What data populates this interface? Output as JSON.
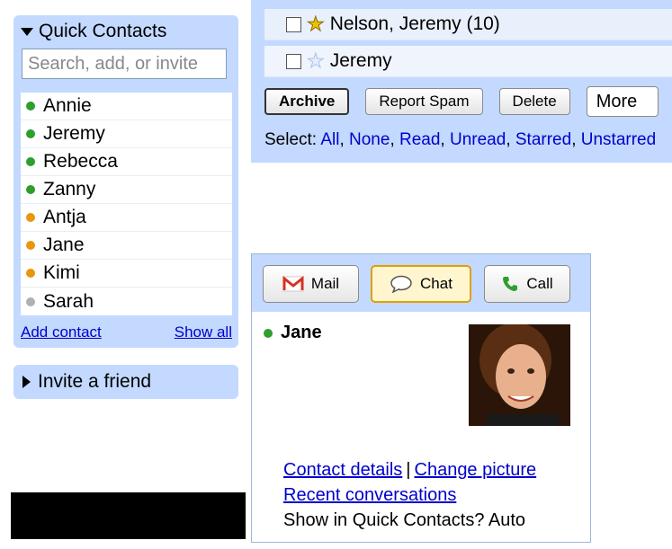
{
  "quick_contacts": {
    "title": "Quick Contacts",
    "search_placeholder": "Search, add, or invite",
    "contacts": [
      {
        "name": "Annie",
        "status": "online"
      },
      {
        "name": "Jeremy",
        "status": "online"
      },
      {
        "name": "Rebecca",
        "status": "online"
      },
      {
        "name": "Zanny",
        "status": "online"
      },
      {
        "name": "Antja",
        "status": "idle"
      },
      {
        "name": "Jane",
        "status": "idle"
      },
      {
        "name": "Kimi",
        "status": "idle"
      },
      {
        "name": "Sarah",
        "status": "offline"
      }
    ],
    "add_contact_label": "Add contact",
    "show_all_label": "Show all"
  },
  "invite": {
    "label": "Invite a friend"
  },
  "mail_list": {
    "rows": [
      {
        "sender": "Nelson, Jeremy (10)",
        "starred": true
      },
      {
        "sender": "Jeremy",
        "starred": false
      }
    ],
    "toolbar": {
      "archive_label": "Archive",
      "report_spam_label": "Report Spam",
      "delete_label": "Delete",
      "more_label": "More"
    },
    "select": {
      "prefix": "Select:",
      "all": "All",
      "none": "None",
      "read": "Read",
      "unread": "Unread",
      "starred": "Starred",
      "unstarred": "Unstarred"
    }
  },
  "contact_card": {
    "mail_label": "Mail",
    "chat_label": "Chat",
    "call_label": "Call",
    "name": "Jane",
    "contact_details_label": "Contact details",
    "separator": "|",
    "change_picture_label": "Change picture",
    "recent_conversations_label": "Recent conversations",
    "show_in_qc_label": "Show in Quick Contacts?",
    "show_in_qc_value": "Auto"
  },
  "colors": {
    "panel_blue": "#c3d9ff",
    "link": "#0000cc",
    "online": "#2e9e2e",
    "idle": "#e8960c",
    "offline": "#b0b0b0"
  }
}
